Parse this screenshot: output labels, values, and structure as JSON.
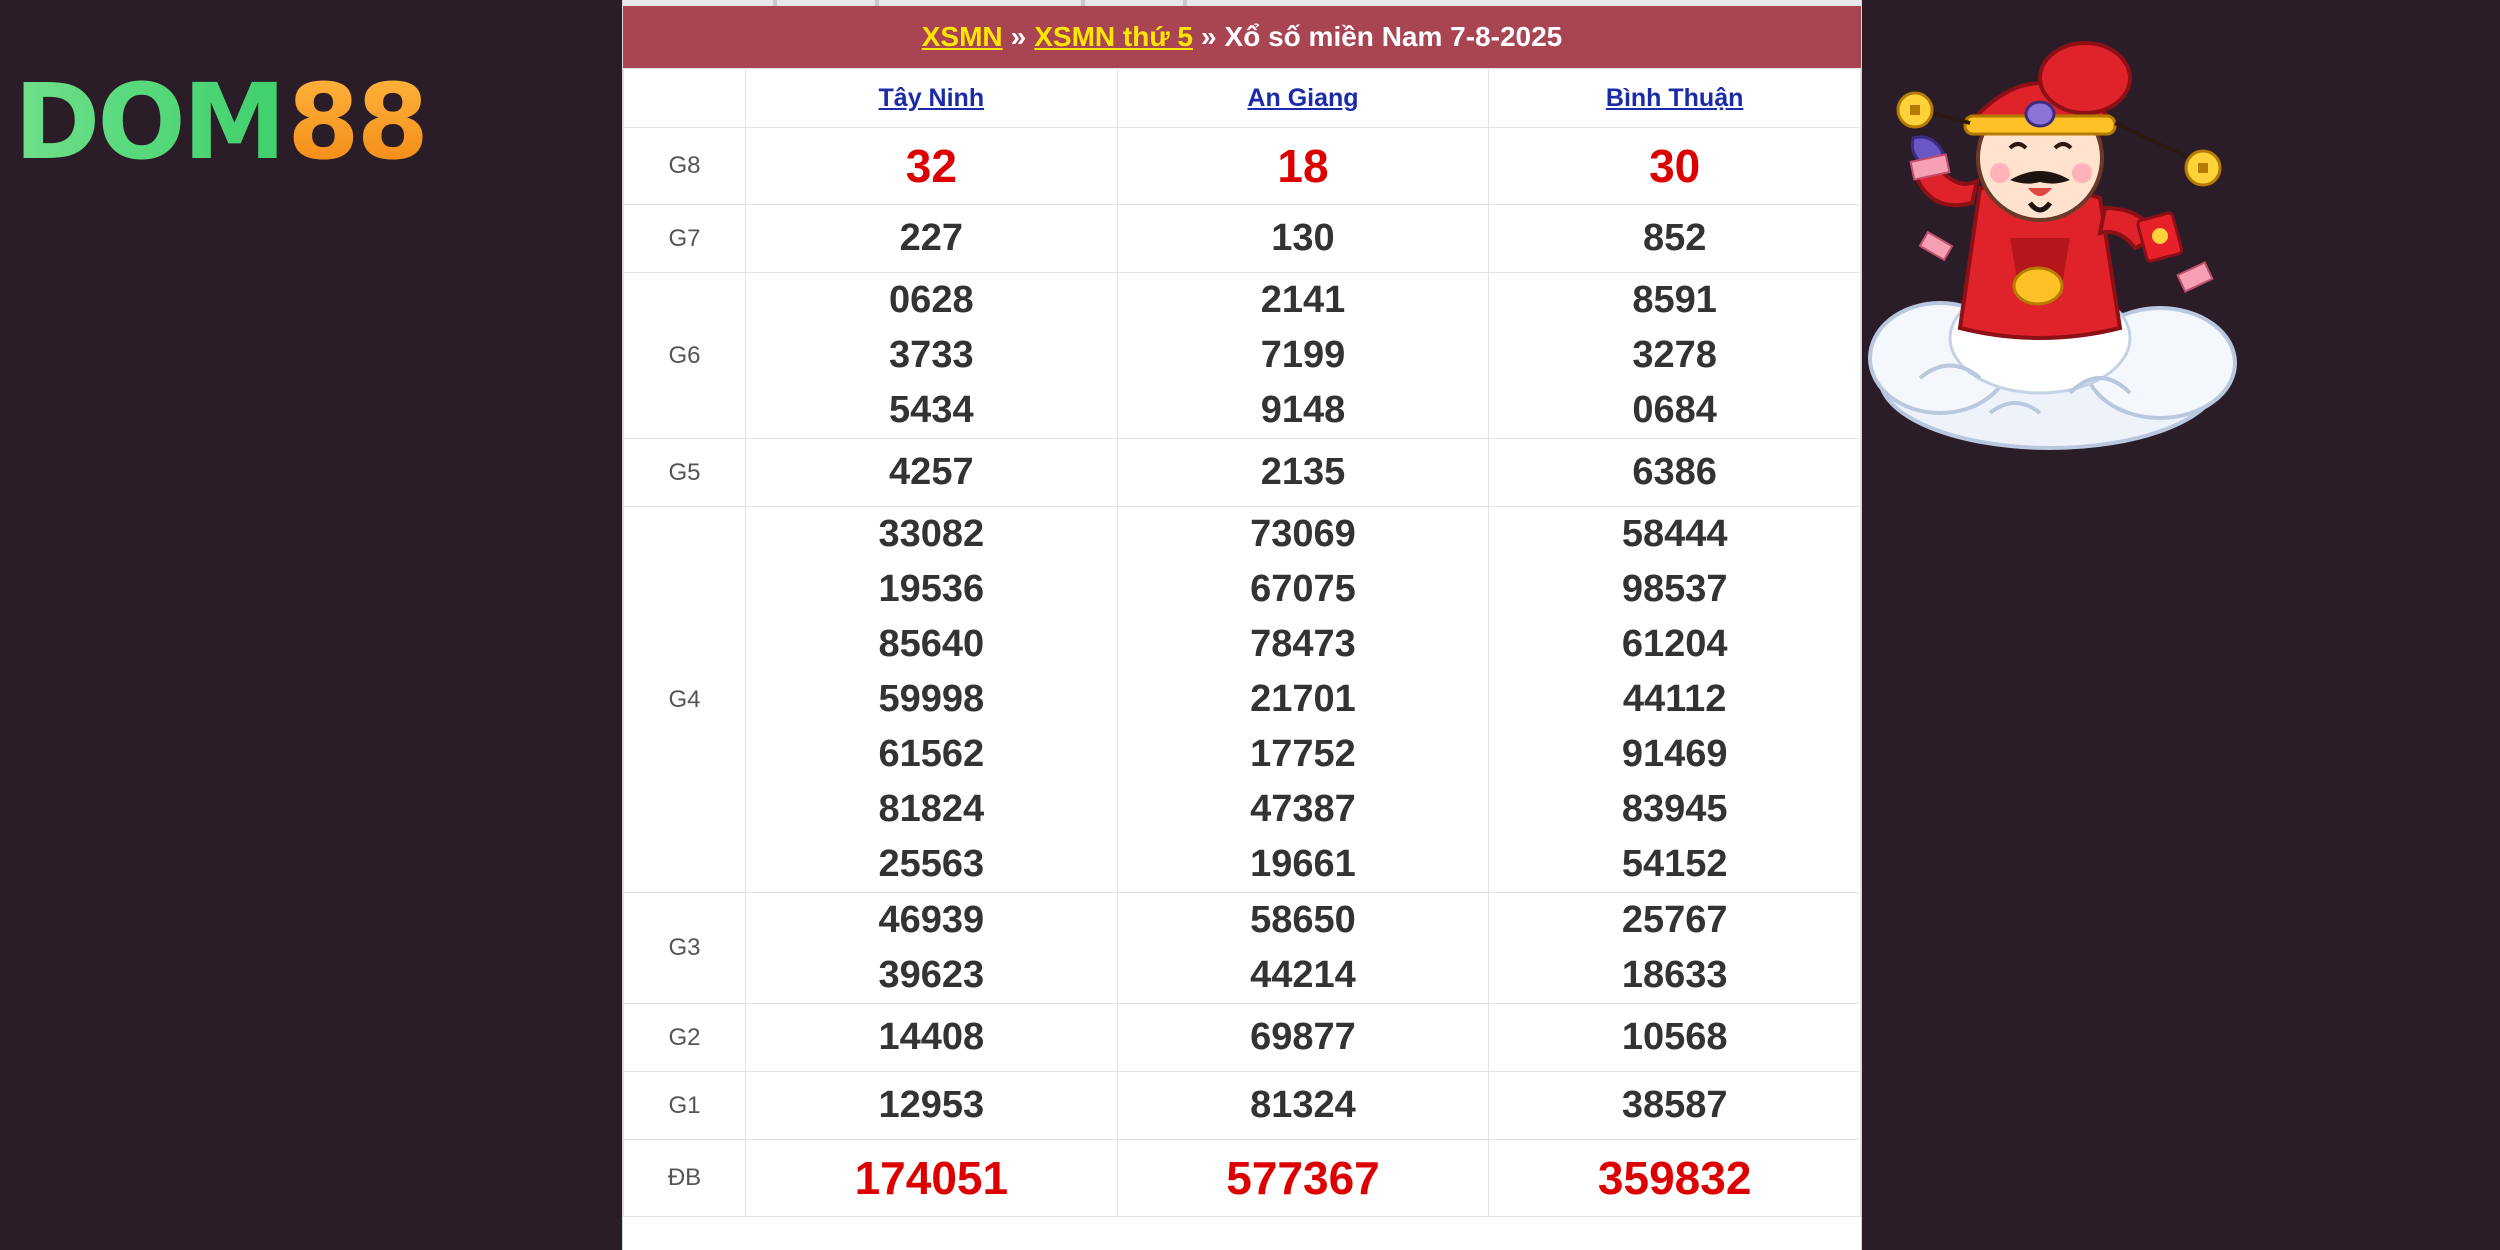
{
  "logo": {
    "word": "DOM",
    "number": "88"
  },
  "header": {
    "link1": "XSMN",
    "sep1": "»",
    "link2": "XSMN thứ 5",
    "sep2": "»",
    "title": "Xổ số miền Nam 7-8-2025"
  },
  "provinces": [
    "Tây Ninh",
    "An Giang",
    "Bình Thuận"
  ],
  "prizes": [
    {
      "label": "G8",
      "values": [
        [
          "32"
        ],
        [
          "18"
        ],
        [
          "30"
        ]
      ]
    },
    {
      "label": "G7",
      "values": [
        [
          "227"
        ],
        [
          "130"
        ],
        [
          "852"
        ]
      ]
    },
    {
      "label": "G6",
      "values": [
        [
          "0628",
          "3733",
          "5434"
        ],
        [
          "2141",
          "7199",
          "9148"
        ],
        [
          "8591",
          "3278",
          "0684"
        ]
      ]
    },
    {
      "label": "G5",
      "values": [
        [
          "4257"
        ],
        [
          "2135"
        ],
        [
          "6386"
        ]
      ]
    },
    {
      "label": "G4",
      "values": [
        [
          "33082",
          "19536",
          "85640",
          "59998",
          "61562",
          "81824",
          "25563"
        ],
        [
          "73069",
          "67075",
          "78473",
          "21701",
          "17752",
          "47387",
          "19661"
        ],
        [
          "58444",
          "98537",
          "61204",
          "44112",
          "91469",
          "83945",
          "54152"
        ]
      ]
    },
    {
      "label": "G3",
      "values": [
        [
          "46939",
          "39623"
        ],
        [
          "58650",
          "44214"
        ],
        [
          "25767",
          "18633"
        ]
      ]
    },
    {
      "label": "G2",
      "values": [
        [
          "14408"
        ],
        [
          "69877"
        ],
        [
          "10568"
        ]
      ]
    },
    {
      "label": "G1",
      "values": [
        [
          "12953"
        ],
        [
          "81324"
        ],
        [
          "38587"
        ]
      ]
    },
    {
      "label": "ĐB",
      "values": [
        [
          "174051"
        ],
        [
          "577367"
        ],
        [
          "359832"
        ]
      ]
    }
  ],
  "colors": {
    "header_bg": "#a94452",
    "header_link": "#ffe600",
    "province_link": "#1a2aa8",
    "highlight": "#dd0000",
    "page_bg": "#2a1d28"
  }
}
